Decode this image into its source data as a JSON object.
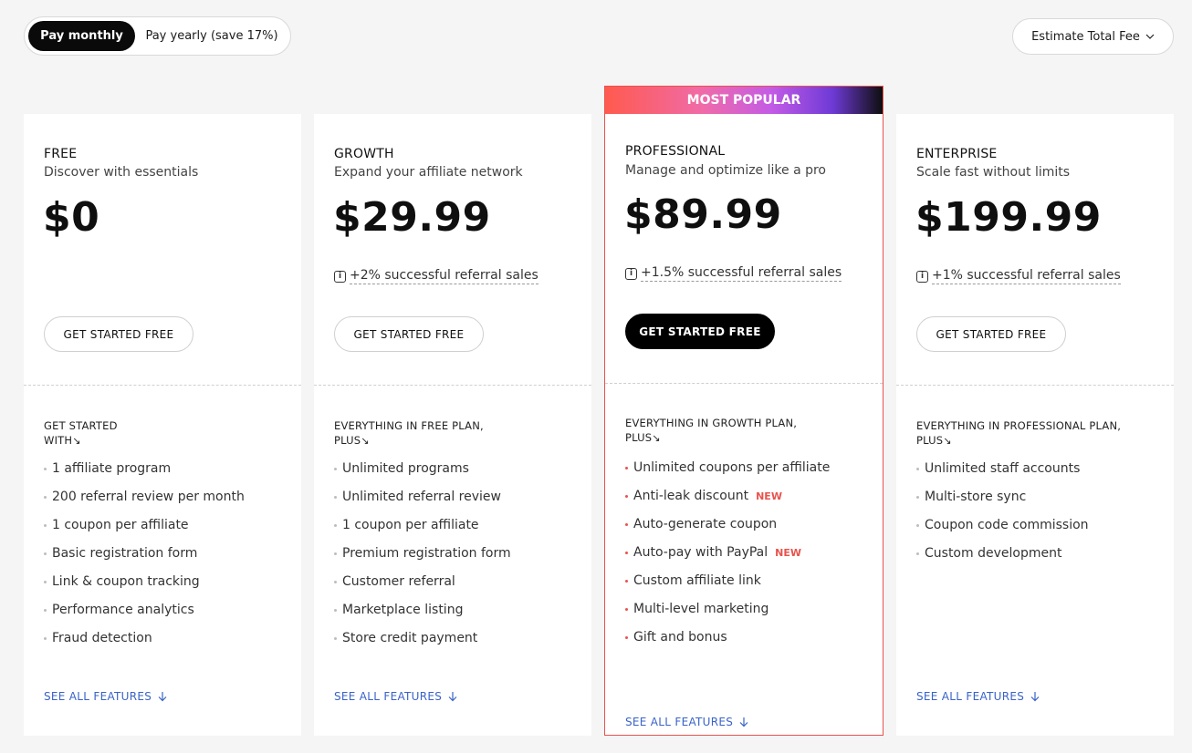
{
  "billing": {
    "monthly_label": "Pay monthly",
    "yearly_label": "Pay yearly (save 17%)"
  },
  "estimate": {
    "label": "Estimate Total Fee"
  },
  "popular_badge": "MOST POPULAR",
  "plans": [
    {
      "name": "FREE",
      "subtitle": "Discover with essentials",
      "price": "$0",
      "fee": "",
      "cta": "GET STARTED FREE",
      "includes_line1": "GET STARTED",
      "includes_line2": "WITH",
      "features": [
        "1 affiliate program",
        "200 referral review per month",
        "1 coupon per affiliate",
        "Basic registration form",
        "Link & coupon tracking",
        "Performance analytics",
        "Fraud detection"
      ],
      "see_all": "SEE ALL FEATURES"
    },
    {
      "name": "GROWTH",
      "subtitle": "Expand your affiliate network",
      "price": "$29.99",
      "fee": "+2% successful referral sales",
      "cta": "GET STARTED FREE",
      "includes_line1": "EVERYTHING IN FREE PLAN,",
      "includes_line2": "PLUS",
      "features": [
        "Unlimited programs",
        "Unlimited referral review",
        "1 coupon per affiliate",
        "Premium registration form",
        "Customer referral",
        "Marketplace listing",
        "Store credit payment"
      ],
      "see_all": "SEE ALL FEATURES"
    },
    {
      "name": "PROFESSIONAL",
      "subtitle": "Manage and optimize like a pro",
      "price": "$89.99",
      "fee": "+1.5% successful referral sales",
      "cta": "GET STARTED FREE",
      "includes_line1": "EVERYTHING IN GROWTH PLAN,",
      "includes_line2": "PLUS",
      "features": [
        "Unlimited coupons per affiliate",
        "Anti-leak discount",
        "Auto-generate coupon",
        "Auto-pay with PayPal",
        "Custom affiliate link",
        "Multi-level marketing",
        "Gift and bonus"
      ],
      "new_tag": "NEW",
      "see_all": "SEE ALL FEATURES"
    },
    {
      "name": "ENTERPRISE",
      "subtitle": "Scale fast without limits",
      "price": "$199.99",
      "fee": "+1% successful referral sales",
      "cta": "GET STARTED FREE",
      "includes_line1": "EVERYTHING IN PROFESSIONAL PLAN,",
      "includes_line2": "PLUS",
      "features": [
        "Unlimited staff accounts",
        "Multi-store sync",
        "Coupon code commission",
        "Custom development"
      ],
      "see_all": "SEE ALL FEATURES"
    }
  ],
  "colors": {
    "accent": "#e8534d",
    "link": "#3a63c8",
    "dark": "#000000"
  }
}
